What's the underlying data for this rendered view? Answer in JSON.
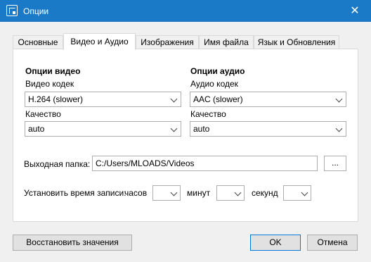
{
  "window": {
    "title": "Опции",
    "close_glyph": "✕",
    "app_icon": "screenshot-icon"
  },
  "tabs": [
    {
      "label": "Основные"
    },
    {
      "label": "Видео и Аудио",
      "active": true
    },
    {
      "label": "Изображения"
    },
    {
      "label": "Имя файла"
    },
    {
      "label": "Язык и Обновления"
    }
  ],
  "video": {
    "title": "Опции видео",
    "codec_label": "Видео кодек",
    "codec_value": "H.264 (slower)",
    "quality_label": "Качество",
    "quality_value": "auto"
  },
  "audio": {
    "title": "Опции аудио",
    "codec_label": "Аудио кодек",
    "codec_value": "AAC (slower)",
    "quality_label": "Качество",
    "quality_value": "auto"
  },
  "output": {
    "label": "Выходная папка:",
    "path": "C:/Users/MLOADS/Videos",
    "browse_label": "..."
  },
  "timer": {
    "label": "Установить время записи:",
    "hours_label": "часов",
    "minutes_label": "минут",
    "seconds_label": "секунд"
  },
  "footer": {
    "restore_label": "Восстановить значения",
    "ok_label": "OK",
    "cancel_label": "Отмена"
  }
}
